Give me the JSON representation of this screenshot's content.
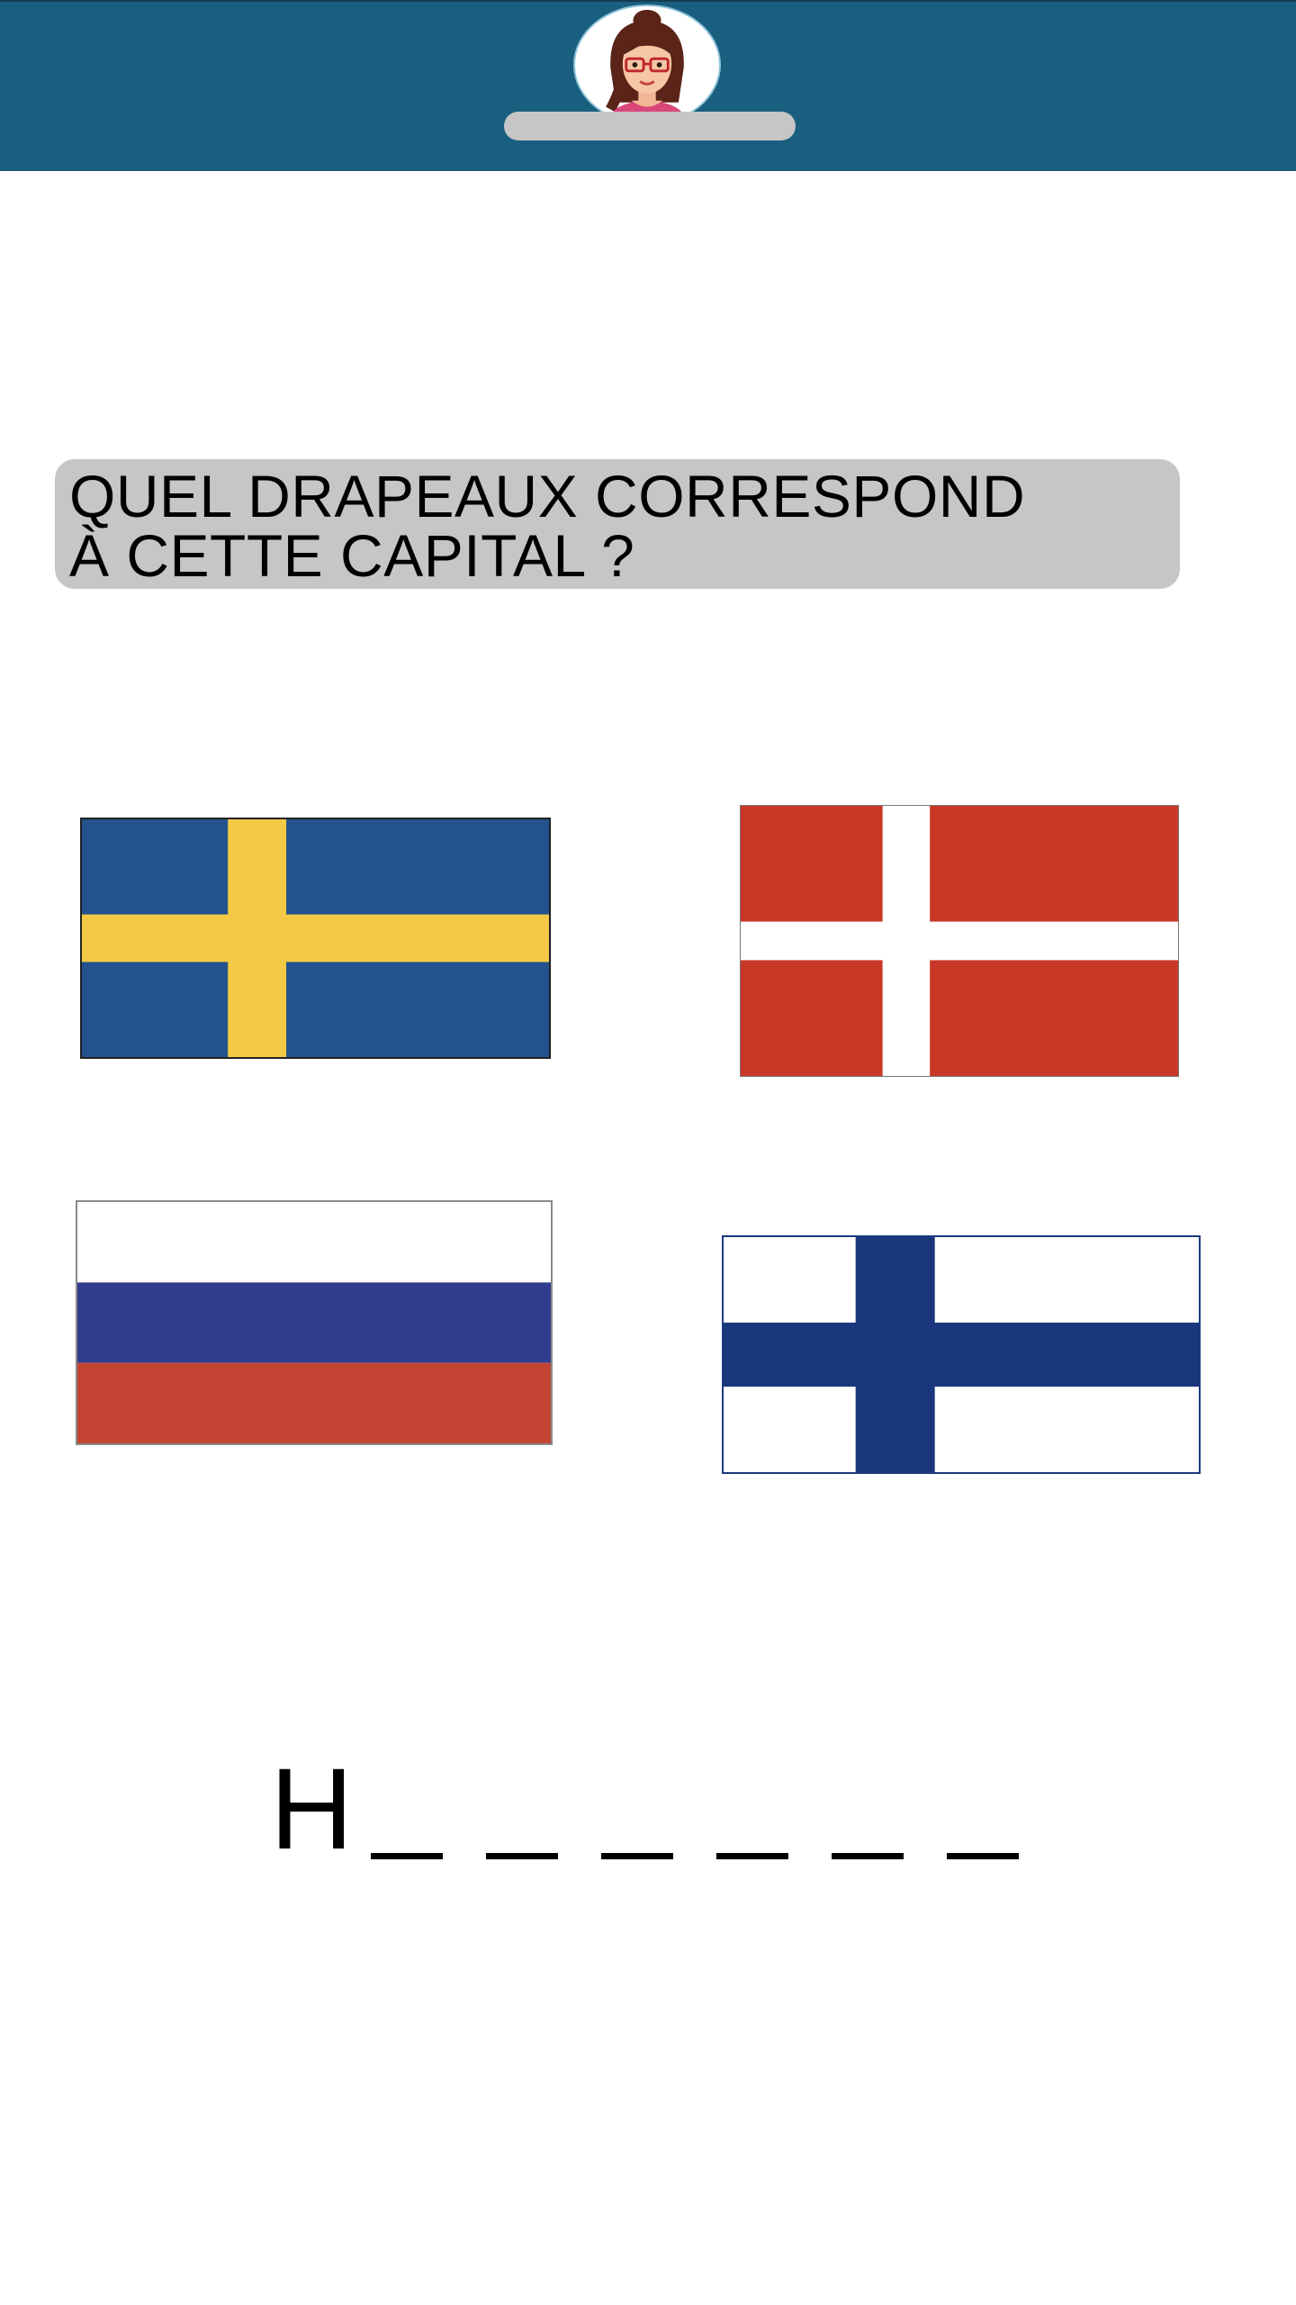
{
  "header": {
    "background_color": "#1a5f80",
    "avatar_icon": "woman-with-glasses-avatar"
  },
  "question": {
    "line1": "QUEL DRAPEAUX CORRESPOND",
    "line2": "À CETTE CAPITAL ?"
  },
  "options": [
    {
      "icon": "sweden-flag-icon",
      "colors": [
        "#24528c",
        "#f3c945"
      ]
    },
    {
      "icon": "denmark-flag-icon",
      "colors": [
        "#c93726",
        "#ffffff"
      ]
    },
    {
      "icon": "russia-flag-icon",
      "colors": [
        "#ffffff",
        "#323c8f",
        "#c44434"
      ]
    },
    {
      "icon": "finland-flag-icon",
      "colors": [
        "#ffffff",
        "#1a367c"
      ]
    }
  ],
  "answer": {
    "first_letter": "H",
    "remaining_letter_count": 6
  }
}
